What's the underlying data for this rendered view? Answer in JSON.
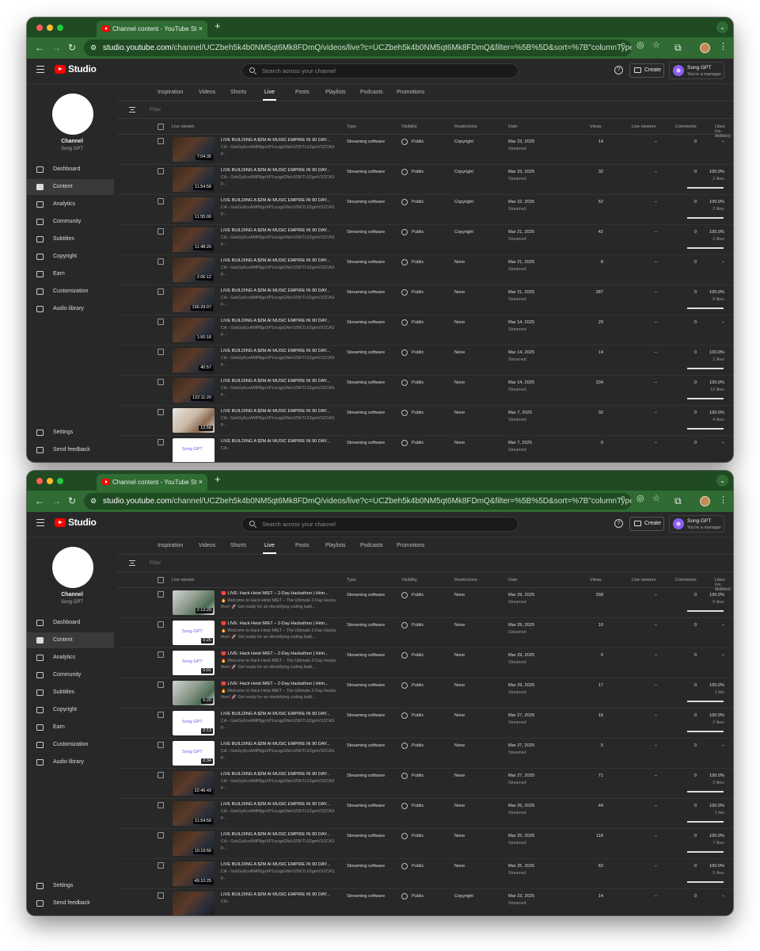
{
  "browser": {
    "tab_title": "Channel content - YouTube St",
    "tab_close": "×",
    "new_tab": "+",
    "tab_menu": "⌄",
    "url_host": "studio.youtube.com",
    "url_path": "/channel/UCZbeh5k4b0NM5qt6Mk8FDmQ/videos/live?c=UCZbeh5k4b0NM5qt6Mk8FDmQ&filter=%5B%5D&sort=%7B\"columnType\"%3A\"..."
  },
  "studio": {
    "logo": "Studio",
    "search_placeholder": "Search across your channel",
    "help": "?",
    "create": "Create",
    "account_name": "Song GPT",
    "account_role": "You're a manager"
  },
  "sidebar": {
    "channel_label": "Channel",
    "channel_name": "Song GPT",
    "items": [
      "Dashboard",
      "Content",
      "Analytics",
      "Community",
      "Subtitles",
      "Copyright",
      "Earn",
      "Customization",
      "Audio library"
    ],
    "settings": "Settings",
    "feedback": "Send feedback"
  },
  "content_tabs": [
    "Inspiration",
    "Videos",
    "Shorts",
    "Live",
    "Posts",
    "Playlists",
    "Podcasts",
    "Promotions"
  ],
  "filter": "Filter",
  "columns": [
    "Live stream",
    "Type",
    "Visibility",
    "Restrictions",
    "Date",
    "Views",
    "Live viewers",
    "Comments",
    "Likes (vs. dislikes)"
  ],
  "window1": {
    "rows": [
      {
        "thumb": "dark",
        "dur": "7:04:35",
        "title": "LIVE BUILDING A $2M AI MUSIC EMPIRE IN 90 DAY...",
        "desc": "CA:- GokGy6cxAMP8goXP1ocqpGNeVZ6KTL62gmVXZCASp...",
        "type": "Streaming software",
        "vis": "Public",
        "restr": "Copyright",
        "date": "Mar 23, 2025",
        "status": "Streamed",
        "views": "14",
        "live": "–",
        "comments": "0",
        "likes": "–",
        "likes_sub": "",
        "like_pct": null
      },
      {
        "thumb": "dark",
        "dur": "11:54:58",
        "title": "LIVE BUILDING A $2M AI MUSIC EMPIRE IN 90 DAY...",
        "desc": "CA:- GokGy6cxAMP8goXP1ocqpGNeVZ6KTL62gmVXZCASp...",
        "type": "Streaming software",
        "vis": "Public",
        "restr": "Copyright",
        "date": "Mar 23, 2025",
        "status": "Streamed",
        "views": "32",
        "live": "–",
        "comments": "0",
        "likes": "100.0%",
        "likes_sub": "2 likes",
        "like_pct": 100
      },
      {
        "thumb": "dark",
        "dur": "11:55:00",
        "title": "LIVE BUILDING A $2M AI MUSIC EMPIRE IN 90 DAY...",
        "desc": "CA:- GokGy6cxAMP8goXP1ocqpGNeVZ6KTL62gmVXZCASp...",
        "type": "Streaming software",
        "vis": "Public",
        "restr": "Copyright",
        "date": "Mar 22, 2025",
        "status": "Streamed",
        "views": "52",
        "live": "–",
        "comments": "0",
        "likes": "100.0%",
        "likes_sub": "2 likes",
        "like_pct": 100
      },
      {
        "thumb": "dark",
        "dur": "11:48:20",
        "title": "LIVE BUILDING A $2M AI MUSIC EMPIRE IN 90 DAY...",
        "desc": "CA:- GokGy6cxAMP8goXP1ocqpGNeVZ6KTL62gmVXZCASp...",
        "type": "Streaming software",
        "vis": "Public",
        "restr": "Copyright",
        "date": "Mar 21, 2025",
        "status": "Streamed",
        "views": "42",
        "live": "–",
        "comments": "0",
        "likes": "100.0%",
        "likes_sub": "2 likes",
        "like_pct": 100
      },
      {
        "thumb": "dark",
        "dur": "2:06:12",
        "title": "LIVE BUILDING A $2M AI MUSIC EMPIRE IN 90 DAY...",
        "desc": "CA:- GokGy6cxAMP8goXP1ocqpGNeVZ6KTL62gmVXZCASp...",
        "type": "Streaming software",
        "vis": "Public",
        "restr": "None",
        "date": "Mar 21, 2025",
        "status": "Streamed",
        "views": "8",
        "live": "–",
        "comments": "0",
        "likes": "–",
        "likes_sub": "",
        "like_pct": null
      },
      {
        "thumb": "dark",
        "dur": "156:29:07",
        "title": "LIVE BUILDING A $2M AI MUSIC EMPIRE IN 90 DAY...",
        "desc": "CA:- GokGy6cxAMP8goXP1ocqpGNeVZ6KTL62gmVXZCASp...",
        "type": "Streaming software",
        "vis": "Public",
        "restr": "None",
        "date": "Mar 21, 2025",
        "status": "Streamed",
        "views": "287",
        "live": "–",
        "comments": "0",
        "likes": "100.0%",
        "likes_sub": "8 likes",
        "like_pct": 100
      },
      {
        "thumb": "dark",
        "dur": "1:50:18",
        "title": "LIVE BUILDING A $2M AI MUSIC EMPIRE IN 90 DAY...",
        "desc": "CA:- GokGy6cxAMP8goXP1ocqpGNeVZ6KTL62gmVXZCASp...",
        "type": "Streaming software",
        "vis": "Public",
        "restr": "None",
        "date": "Mar 14, 2025",
        "status": "Streamed",
        "views": "29",
        "live": "–",
        "comments": "0",
        "likes": "–",
        "likes_sub": "",
        "like_pct": null
      },
      {
        "thumb": "dark",
        "dur": "40:57",
        "title": "LIVE BUILDING A $2M AI MUSIC EMPIRE IN 90 DAY...",
        "desc": "CA:- GokGy6cxAMP8goXP1ocqpGNeVZ6KTL62gmVXZCASp...",
        "type": "Streaming software",
        "vis": "Public",
        "restr": "None",
        "date": "Mar 14, 2025",
        "status": "Streamed",
        "views": "14",
        "live": "–",
        "comments": "0",
        "likes": "100.0%",
        "likes_sub": "2 likes",
        "like_pct": 100
      },
      {
        "thumb": "dark",
        "dur": "122:11:20",
        "title": "LIVE BUILDING A $2M AI MUSIC EMPIRE IN 90 DAY...",
        "desc": "CA:- GokGy6cxAMP8goXP1ocqpGNeVZ6KTL62gmVXZCASp...",
        "type": "Streaming software",
        "vis": "Public",
        "restr": "None",
        "date": "Mar 14, 2025",
        "status": "Streamed",
        "views": "334",
        "live": "–",
        "comments": "0",
        "likes": "100.0%",
        "likes_sub": "12 likes",
        "like_pct": 100
      },
      {
        "thumb": "face",
        "dur": "12:56",
        "title": "LIVE BUILDING A $2M AI MUSIC EMPIRE IN 90 DAY...",
        "desc": "CA:- GokGy6cxAMP8goXP1ocqpGNeVZ6KTL62gmVXZCASp...",
        "type": "Streaming software",
        "vis": "Public",
        "restr": "None",
        "date": "Mar 7, 2025",
        "status": "Streamed",
        "views": "32",
        "live": "–",
        "comments": "0",
        "likes": "100.0%",
        "likes_sub": "4 likes",
        "like_pct": 100
      },
      {
        "thumb": "song",
        "dur": "",
        "title": "LIVE BUILDING A $2M AI MUSIC EMPIRE IN 90 DAY...",
        "desc": "CA:-",
        "type": "Streaming software",
        "vis": "Public",
        "restr": "None",
        "date": "Mar 7, 2025",
        "status": "Streamed",
        "views": "0",
        "live": "–",
        "comments": "0",
        "likes": "–",
        "likes_sub": "",
        "like_pct": null
      }
    ]
  },
  "window2": {
    "rows": [
      {
        "thumb": "room",
        "dur": "2:13:20",
        "title": "🔴 LIVE: Hack Heist MIET – 2-Day Hackathon | Hirin...",
        "desc": "🔥 Welcome to Hack Heist MIET – The Ultimate 2-Day Hackathon! 🚀 Get ready for an electrifying coding battl...",
        "type": "Streaming software",
        "vis": "Public",
        "restr": "None",
        "date": "Mar 29, 2025",
        "status": "Streamed",
        "views": "268",
        "live": "–",
        "comments": "0",
        "likes": "100.0%",
        "likes_sub": "8 likes",
        "like_pct": 100
      },
      {
        "thumb": "song",
        "dur": "0:25",
        "title": "🔴 LIVE: Hack Heist MIET – 2-Day Hackathon | Hirin...",
        "desc": "🔥 Welcome to Hack Heist MIET – The Ultimate 2-Day Hackathon! 🚀 Get ready for an electrifying coding battl...",
        "type": "Streaming software",
        "vis": "Public",
        "restr": "None",
        "date": "Mar 29, 2025",
        "status": "Streamed",
        "views": "10",
        "live": "–",
        "comments": "0",
        "likes": "–",
        "likes_sub": "",
        "like_pct": null
      },
      {
        "thumb": "song",
        "dur": "0:01",
        "title": "🔴 LIVE: Hack Heist MIET – 2-Day Hackathon | Hirin...",
        "desc": "🔥 Welcome to Hack Heist MIET – The Ultimate 2-Day Hackathon! 🚀 Get ready for an electrifying coding battl...",
        "type": "Streaming software",
        "vis": "Public",
        "restr": "None",
        "date": "Mar 29, 2025",
        "status": "Streamed",
        "views": "0",
        "live": "–",
        "comments": "0",
        "likes": "–",
        "likes_sub": "",
        "like_pct": null
      },
      {
        "thumb": "room",
        "dur": "5:20",
        "title": "🔴 LIVE: Hack Heist MIET – 2-Day Hackathon | Hirin...",
        "desc": "🔥 Welcome to Hack Heist MIET – The Ultimate 2-Day Hackathon! 🚀 Get ready for an electrifying coding battl...",
        "type": "Streaming software",
        "vis": "Public",
        "restr": "None",
        "date": "Mar 29, 2025",
        "status": "Streamed",
        "views": "17",
        "live": "–",
        "comments": "0",
        "likes": "100.0%",
        "likes_sub": "1 like",
        "like_pct": 100
      },
      {
        "thumb": "song",
        "dur": "0:13",
        "title": "LIVE BUILDING A $2M AI MUSIC EMPIRE IN 90 DAY...",
        "desc": "CA:- GokGy6cxAMP8goXP1ocqpGNeVZ6KTL62gmVXZCASp...",
        "type": "Streaming software",
        "vis": "Public",
        "restr": "None",
        "date": "Mar 27, 2025",
        "status": "Streamed",
        "views": "16",
        "live": "–",
        "comments": "0",
        "likes": "100.0%",
        "likes_sub": "2 likes",
        "like_pct": 100
      },
      {
        "thumb": "song",
        "dur": "0:34",
        "title": "LIVE BUILDING A $2M AI MUSIC EMPIRE IN 90 DAY...",
        "desc": "CA:- GokGy6cxAMP8goXP1ocqpGNeVZ6KTL62gmVXZCASp...",
        "type": "Streaming software",
        "vis": "Public",
        "restr": "None",
        "date": "Mar 27, 2025",
        "status": "Streamed",
        "views": "5",
        "live": "–",
        "comments": "0",
        "likes": "–",
        "likes_sub": "",
        "like_pct": null
      },
      {
        "thumb": "dark",
        "dur": "22:46:43",
        "title": "LIVE BUILDING A $2M AI MUSIC EMPIRE IN 90 DAY...",
        "desc": "CA:- GokGy6cxAMP8goXP1ocqpGNeVZ6KTL62gmVXZCASp...",
        "type": "Streaming software",
        "vis": "Public",
        "restr": "None",
        "date": "Mar 27, 2025",
        "status": "Streamed",
        "views": "71",
        "live": "–",
        "comments": "0",
        "likes": "100.0%",
        "likes_sub": "2 likes",
        "like_pct": 100
      },
      {
        "thumb": "dark",
        "dur": "11:54:59",
        "title": "LIVE BUILDING A $2M AI MUSIC EMPIRE IN 90 DAY...",
        "desc": "CA:- GokGy6cxAMP8goXP1ocqpGNeVZ6KTL62gmVXZCASp...",
        "type": "Streaming software",
        "vis": "Public",
        "restr": "None",
        "date": "Mar 26, 2025",
        "status": "Streamed",
        "views": "44",
        "live": "–",
        "comments": "0",
        "likes": "100.0%",
        "likes_sub": "1 like",
        "like_pct": 100
      },
      {
        "thumb": "dark",
        "dur": "10:19:56",
        "title": "LIVE BUILDING A $2M AI MUSIC EMPIRE IN 90 DAY...",
        "desc": "CA:- GokGy6cxAMP8goXP1ocqpGNeVZ6KTL62gmVXZCASp...",
        "type": "Streaming software",
        "vis": "Public",
        "restr": "None",
        "date": "Mar 25, 2025",
        "status": "Streamed",
        "views": "118",
        "live": "–",
        "comments": "0",
        "likes": "100.0%",
        "likes_sub": "7 likes",
        "like_pct": 100
      },
      {
        "thumb": "dark",
        "dur": "49:10:25",
        "title": "LIVE BUILDING A $2M AI MUSIC EMPIRE IN 90 DAY...",
        "desc": "CA:- GokGy6cxAMP8goXP1ocqpGNeVZ6KTL62gmVXZCASp...",
        "type": "Streaming software",
        "vis": "Public",
        "restr": "None",
        "date": "Mar 25, 2025",
        "status": "Streamed",
        "views": "83",
        "live": "–",
        "comments": "0",
        "likes": "100.0%",
        "likes_sub": "5 likes",
        "like_pct": 100
      },
      {
        "thumb": "dark",
        "dur": "",
        "title": "LIVE BUILDING A $2M AI MUSIC EMPIRE IN 90 DAY...",
        "desc": "CA:-",
        "type": "Streaming software",
        "vis": "Public",
        "restr": "Copyright",
        "date": "Mar 23, 2025",
        "status": "Streamed",
        "views": "14",
        "live": "–",
        "comments": "0",
        "likes": "–",
        "likes_sub": "",
        "like_pct": null
      }
    ]
  }
}
